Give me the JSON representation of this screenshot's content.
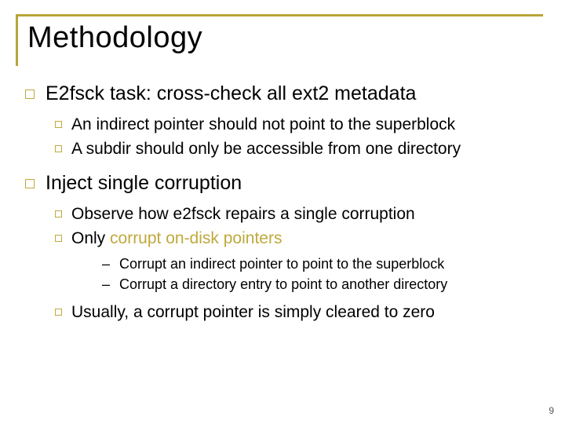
{
  "title": "Methodology",
  "s1": {
    "head": "E2fsck task: cross-check all ext2 metadata",
    "b1": "An indirect pointer should not point to the superblock",
    "b2": "A subdir should only be accessible from one directory"
  },
  "s2": {
    "head": "Inject single corruption",
    "b1": "Observe how e2fsck repairs a single corruption",
    "b2a": "Only ",
    "b2b": "corrupt on-disk pointers",
    "c1": "Corrupt an indirect pointer to point to the superblock",
    "c2": "Corrupt a directory entry to point to another directory",
    "b3": "Usually, a corrupt pointer is simply cleared to zero"
  },
  "page": "9"
}
